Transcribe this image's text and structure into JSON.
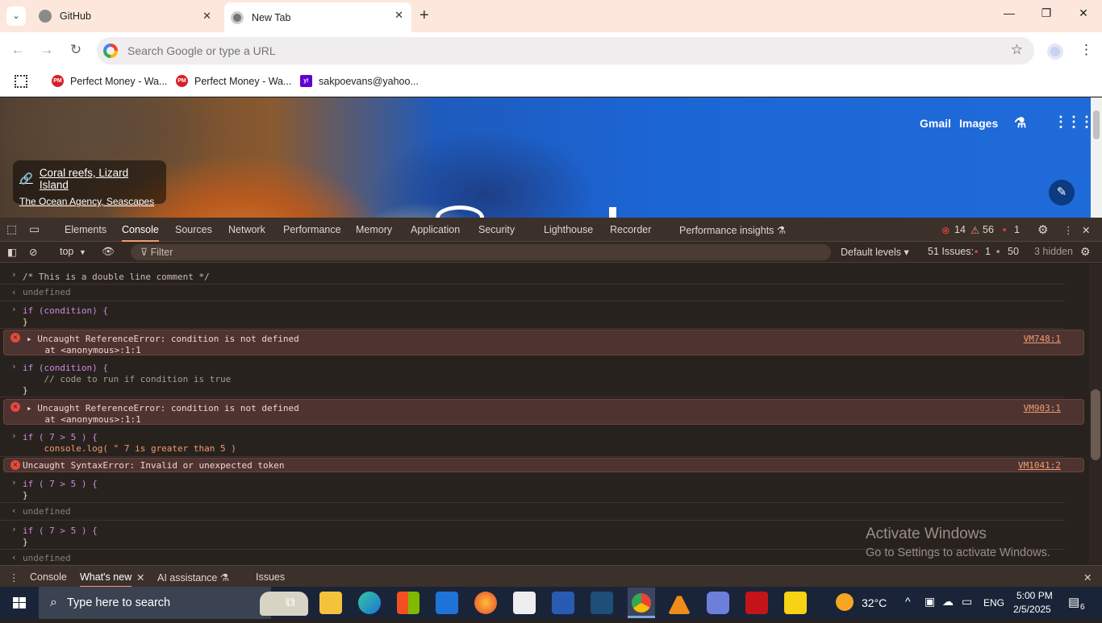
{
  "tabs": [
    {
      "title": "GitHub"
    },
    {
      "title": "New Tab"
    }
  ],
  "omnibox": {
    "placeholder": "Search Google or type a URL"
  },
  "bookmarks": [
    {
      "label": "Perfect Money - Wa...",
      "icon": "PM"
    },
    {
      "label": "Perfect Money - Wa...",
      "icon": "PM"
    },
    {
      "label": "sakpoevans@yahoo...",
      "icon": "y!"
    }
  ],
  "newtab": {
    "credit_title": "Coral reefs, Lizard Island",
    "credit_sub": "The Ocean Agency, Seascapes",
    "gmail": "Gmail",
    "images": "Images"
  },
  "devtools": {
    "tabs": [
      "Elements",
      "Console",
      "Sources",
      "Network",
      "Performance",
      "Memory",
      "Application",
      "Security",
      "Lighthouse",
      "Recorder",
      "Performance insights ⚗"
    ],
    "counts": {
      "errors": "14",
      "warnings": "56",
      "issues": "1"
    },
    "filter": {
      "context": "top",
      "placeholder": "Filter",
      "levels": "Default levels ▾",
      "issues_label": "51 Issues:",
      "issues_err": "1",
      "issues_warn": "50",
      "hidden": "3 hidden"
    },
    "console": {
      "r1": "/* This is a double line comment */",
      "r2": "undefined",
      "r3a": "if (condition) {",
      "r3b": "}",
      "e1a": "Uncaught ReferenceError: condition is not defined",
      "e1b": "    at <anonymous>:1:1",
      "e1src": "VM748:1",
      "r4a": "if (condition) {",
      "r4b": "    // code to run if condition is true",
      "r4c": "}",
      "e2a": "Uncaught ReferenceError: condition is not defined",
      "e2b": "    at <anonymous>:1:1",
      "e2src": "VM903:1",
      "r5a": "if ( 7 > 5 ) {",
      "r5b": "    console.log( \" 7 is greater than 5 )",
      "e3": "Uncaught SyntaxError: Invalid or unexpected token",
      "e3src": "VM1041:2",
      "r6a": "if ( 7 > 5 ) {",
      "r6b": "}",
      "r6c": "undefined",
      "r7a": "if ( 7 > 5 ) {",
      "r7b": "}",
      "r7c": "undefined"
    },
    "drawer": [
      "Console",
      "What's new",
      "AI assistance ⚗",
      "Issues"
    ]
  },
  "watermark": {
    "line1": "Activate Windows",
    "line2": "Go to Settings to activate Windows."
  },
  "taskbar": {
    "search": "Type here to search",
    "temp": "32°C",
    "lang": "ENG",
    "time": "5:00 PM",
    "date": "2/5/2025",
    "notif": "6"
  }
}
